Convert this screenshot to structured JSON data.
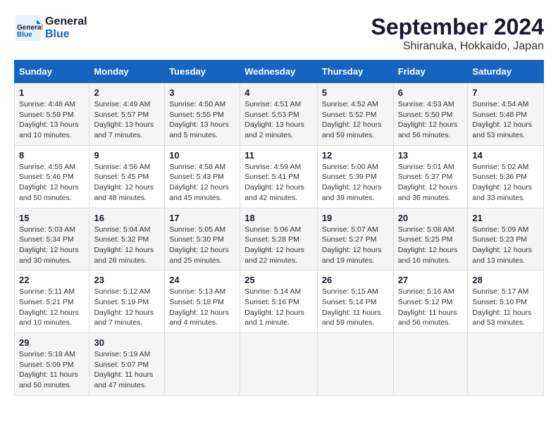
{
  "header": {
    "logo": {
      "general": "General",
      "blue": "Blue"
    },
    "month": "September 2024",
    "location": "Shiranuka, Hokkaido, Japan"
  },
  "weekdays": [
    "Sunday",
    "Monday",
    "Tuesday",
    "Wednesday",
    "Thursday",
    "Friday",
    "Saturday"
  ],
  "weeks": [
    [
      {
        "day": "1",
        "sunrise": "Sunrise: 4:48 AM",
        "sunset": "Sunset: 5:59 PM",
        "daylight": "Daylight: 13 hours and 10 minutes."
      },
      {
        "day": "2",
        "sunrise": "Sunrise: 4:49 AM",
        "sunset": "Sunset: 5:57 PM",
        "daylight": "Daylight: 13 hours and 7 minutes."
      },
      {
        "day": "3",
        "sunrise": "Sunrise: 4:50 AM",
        "sunset": "Sunset: 5:55 PM",
        "daylight": "Daylight: 13 hours and 5 minutes."
      },
      {
        "day": "4",
        "sunrise": "Sunrise: 4:51 AM",
        "sunset": "Sunset: 5:53 PM",
        "daylight": "Daylight: 13 hours and 2 minutes."
      },
      {
        "day": "5",
        "sunrise": "Sunrise: 4:52 AM",
        "sunset": "Sunset: 5:52 PM",
        "daylight": "Daylight: 12 hours and 59 minutes."
      },
      {
        "day": "6",
        "sunrise": "Sunrise: 4:53 AM",
        "sunset": "Sunset: 5:50 PM",
        "daylight": "Daylight: 12 hours and 56 minutes."
      },
      {
        "day": "7",
        "sunrise": "Sunrise: 4:54 AM",
        "sunset": "Sunset: 5:48 PM",
        "daylight": "Daylight: 12 hours and 53 minutes."
      }
    ],
    [
      {
        "day": "8",
        "sunrise": "Sunrise: 4:55 AM",
        "sunset": "Sunset: 5:46 PM",
        "daylight": "Daylight: 12 hours and 50 minutes."
      },
      {
        "day": "9",
        "sunrise": "Sunrise: 4:56 AM",
        "sunset": "Sunset: 5:45 PM",
        "daylight": "Daylight: 12 hours and 48 minutes."
      },
      {
        "day": "10",
        "sunrise": "Sunrise: 4:58 AM",
        "sunset": "Sunset: 5:43 PM",
        "daylight": "Daylight: 12 hours and 45 minutes."
      },
      {
        "day": "11",
        "sunrise": "Sunrise: 4:59 AM",
        "sunset": "Sunset: 5:41 PM",
        "daylight": "Daylight: 12 hours and 42 minutes."
      },
      {
        "day": "12",
        "sunrise": "Sunrise: 5:00 AM",
        "sunset": "Sunset: 5:39 PM",
        "daylight": "Daylight: 12 hours and 39 minutes."
      },
      {
        "day": "13",
        "sunrise": "Sunrise: 5:01 AM",
        "sunset": "Sunset: 5:37 PM",
        "daylight": "Daylight: 12 hours and 36 minutes."
      },
      {
        "day": "14",
        "sunrise": "Sunrise: 5:02 AM",
        "sunset": "Sunset: 5:36 PM",
        "daylight": "Daylight: 12 hours and 33 minutes."
      }
    ],
    [
      {
        "day": "15",
        "sunrise": "Sunrise: 5:03 AM",
        "sunset": "Sunset: 5:34 PM",
        "daylight": "Daylight: 12 hours and 30 minutes."
      },
      {
        "day": "16",
        "sunrise": "Sunrise: 5:04 AM",
        "sunset": "Sunset: 5:32 PM",
        "daylight": "Daylight: 12 hours and 28 minutes."
      },
      {
        "day": "17",
        "sunrise": "Sunrise: 5:05 AM",
        "sunset": "Sunset: 5:30 PM",
        "daylight": "Daylight: 12 hours and 25 minutes."
      },
      {
        "day": "18",
        "sunrise": "Sunrise: 5:06 AM",
        "sunset": "Sunset: 5:28 PM",
        "daylight": "Daylight: 12 hours and 22 minutes."
      },
      {
        "day": "19",
        "sunrise": "Sunrise: 5:07 AM",
        "sunset": "Sunset: 5:27 PM",
        "daylight": "Daylight: 12 hours and 19 minutes."
      },
      {
        "day": "20",
        "sunrise": "Sunrise: 5:08 AM",
        "sunset": "Sunset: 5:25 PM",
        "daylight": "Daylight: 12 hours and 16 minutes."
      },
      {
        "day": "21",
        "sunrise": "Sunrise: 5:09 AM",
        "sunset": "Sunset: 5:23 PM",
        "daylight": "Daylight: 12 hours and 13 minutes."
      }
    ],
    [
      {
        "day": "22",
        "sunrise": "Sunrise: 5:11 AM",
        "sunset": "Sunset: 5:21 PM",
        "daylight": "Daylight: 12 hours and 10 minutes."
      },
      {
        "day": "23",
        "sunrise": "Sunrise: 5:12 AM",
        "sunset": "Sunset: 5:19 PM",
        "daylight": "Daylight: 12 hours and 7 minutes."
      },
      {
        "day": "24",
        "sunrise": "Sunrise: 5:13 AM",
        "sunset": "Sunset: 5:18 PM",
        "daylight": "Daylight: 12 hours and 4 minutes."
      },
      {
        "day": "25",
        "sunrise": "Sunrise: 5:14 AM",
        "sunset": "Sunset: 5:16 PM",
        "daylight": "Daylight: 12 hours and 1 minute."
      },
      {
        "day": "26",
        "sunrise": "Sunrise: 5:15 AM",
        "sunset": "Sunset: 5:14 PM",
        "daylight": "Daylight: 11 hours and 59 minutes."
      },
      {
        "day": "27",
        "sunrise": "Sunrise: 5:16 AM",
        "sunset": "Sunset: 5:12 PM",
        "daylight": "Daylight: 11 hours and 56 minutes."
      },
      {
        "day": "28",
        "sunrise": "Sunrise: 5:17 AM",
        "sunset": "Sunset: 5:10 PM",
        "daylight": "Daylight: 11 hours and 53 minutes."
      }
    ],
    [
      {
        "day": "29",
        "sunrise": "Sunrise: 5:18 AM",
        "sunset": "Sunset: 5:09 PM",
        "daylight": "Daylight: 11 hours and 50 minutes."
      },
      {
        "day": "30",
        "sunrise": "Sunrise: 5:19 AM",
        "sunset": "Sunset: 5:07 PM",
        "daylight": "Daylight: 11 hours and 47 minutes."
      },
      null,
      null,
      null,
      null,
      null
    ]
  ]
}
